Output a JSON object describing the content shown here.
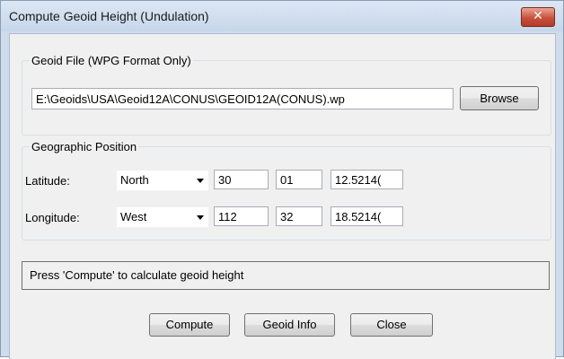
{
  "window": {
    "title": "Compute Geoid Height (Undulation)",
    "close_glyph": "✕"
  },
  "geoid_file": {
    "legend": "Geoid File (WPG Format Only)",
    "path": "E:\\Geoids\\USA\\Geoid12A\\CONUS\\GEOID12A(CONUS).wp",
    "browse_label": "Browse"
  },
  "position": {
    "legend": "Geographic Position",
    "latitude": {
      "label": "Latitude:",
      "hemisphere": "North",
      "degrees": "30",
      "minutes": "01",
      "seconds": "12.5214("
    },
    "longitude": {
      "label": "Longitude:",
      "hemisphere": "West",
      "degrees": "112",
      "minutes": "32",
      "seconds": "18.5214("
    }
  },
  "status_text": "Press 'Compute' to calculate geoid height",
  "buttons": {
    "compute": "Compute",
    "geoid_info": "Geoid Info",
    "close": "Close"
  }
}
